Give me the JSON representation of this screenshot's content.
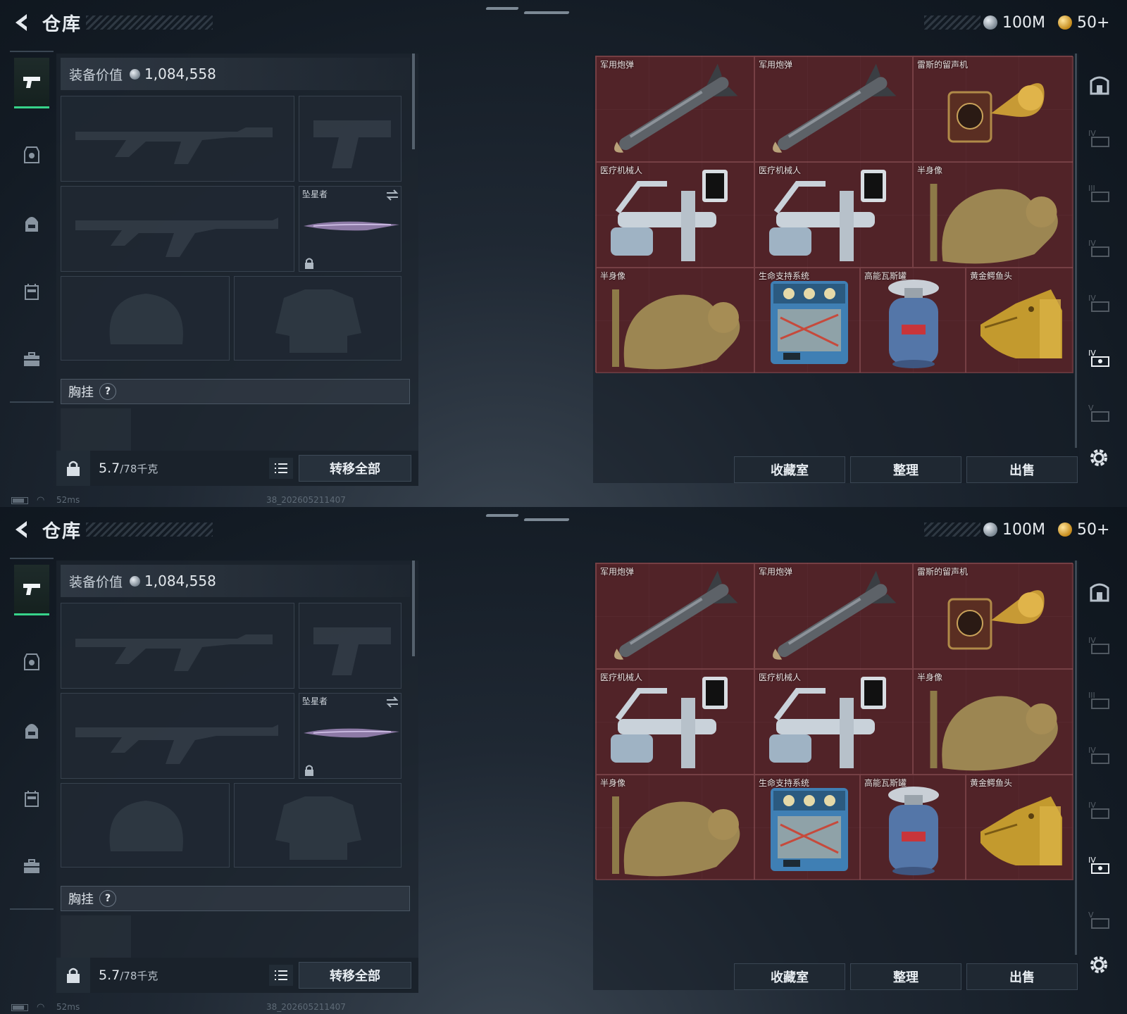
{
  "colors": {
    "accent_green": "#37d38a",
    "grid_red": "#4a1f24",
    "bg_dark": "#131b24"
  },
  "screens": [
    {
      "header": {
        "title": "仓库",
        "back_icon": "back-arrow-icon"
      },
      "currency": {
        "silver": "100M",
        "gold": "50+"
      },
      "left_nav": [
        "pistol-icon",
        "armor-icon",
        "backpack-icon",
        "chest-rig-icon",
        "briefcase-icon"
      ],
      "loadout": {
        "value_label": "装备价值",
        "value": "1,084,558",
        "melee_label": "坠星者",
        "chest_label": "胸挂",
        "chest_help": "?",
        "weight_current": "5.7",
        "weight_capacity": "/78千克",
        "transfer_all": "转移全部"
      },
      "storage": {
        "items": [
          "军用炮弹",
          "军用炮弹",
          "雷斯的留声机",
          "医疗机械人",
          "医疗机械人",
          "半身像",
          "半身像",
          "生命支持系统",
          "高能瓦斯罐",
          "黄金鳄鱼头"
        ]
      },
      "actions": {
        "collection": "收藏室",
        "sort": "整理",
        "sell": "出售"
      },
      "status": {
        "ping": "52ms",
        "build": "38_202605211407"
      }
    },
    {
      "header": {
        "title": "仓库",
        "back_icon": "back-arrow-icon"
      },
      "currency": {
        "silver": "100M",
        "gold": "50+"
      },
      "left_nav": [
        "pistol-icon",
        "armor-icon",
        "backpack-icon",
        "chest-rig-icon",
        "briefcase-icon"
      ],
      "loadout": {
        "value_label": "装备价值",
        "value": "1,084,558",
        "melee_label": "坠星者",
        "chest_label": "胸挂",
        "chest_help": "?",
        "weight_current": "5.7",
        "weight_capacity": "/78千克",
        "transfer_all": "转移全部"
      },
      "storage": {
        "items": [
          "军用炮弹",
          "军用炮弹",
          "雷斯的留声机",
          "医疗机械人",
          "医疗机械人",
          "半身像",
          "半身像",
          "生命支持系统",
          "高能瓦斯罐",
          "黄金鳄鱼头"
        ]
      },
      "actions": {
        "collection": "收藏室",
        "sort": "整理",
        "sell": "出售"
      },
      "status": {
        "ping": "52ms",
        "build": "38_202605211407"
      }
    }
  ]
}
